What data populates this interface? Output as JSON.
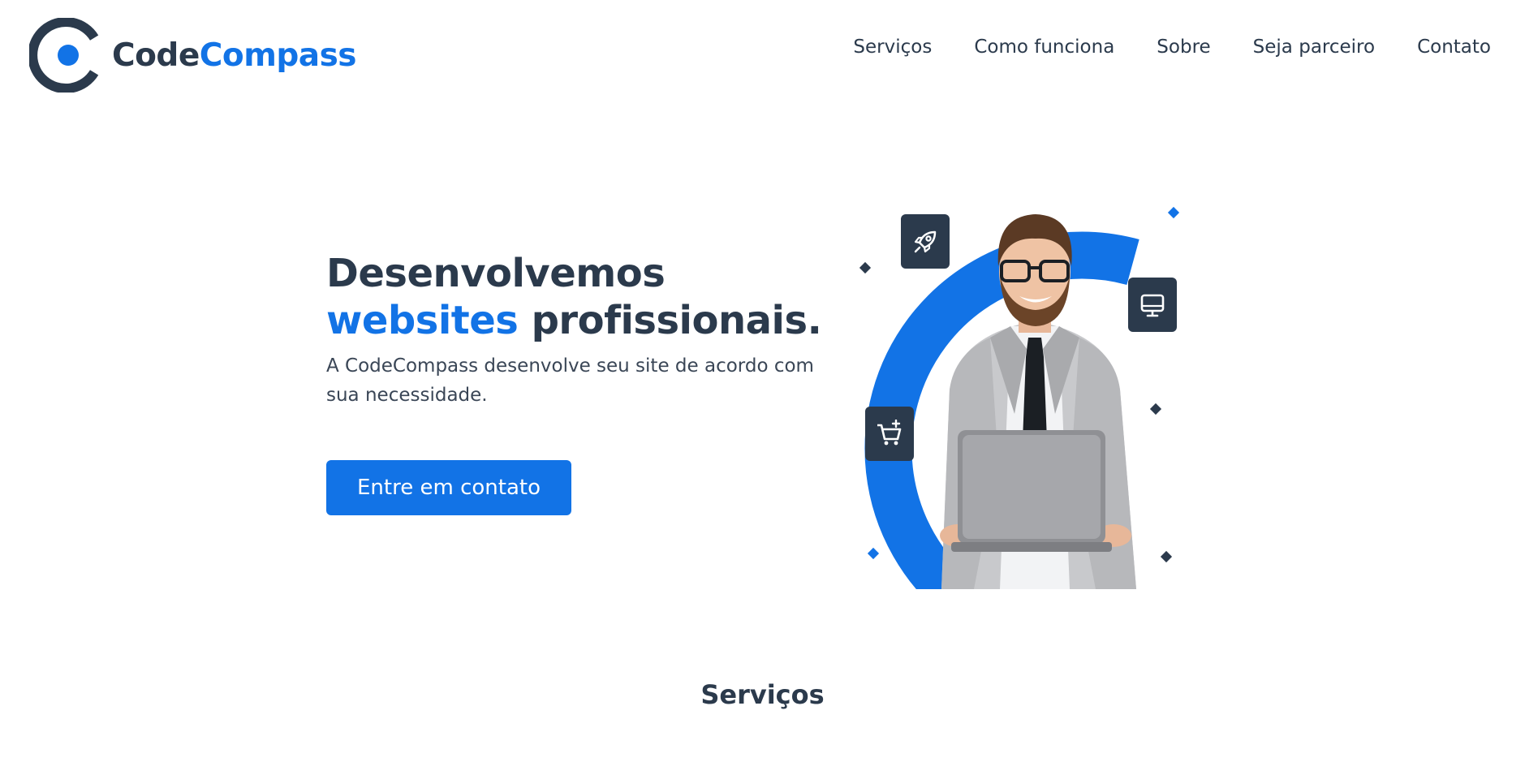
{
  "brand": {
    "name_part1": "Code",
    "name_part2": "Compass",
    "primary_color": "#1273e6",
    "dark_color": "#2b3a4c"
  },
  "nav": {
    "items": [
      {
        "label": "Serviços"
      },
      {
        "label": "Como funciona"
      },
      {
        "label": "Sobre"
      },
      {
        "label": "Seja parceiro"
      },
      {
        "label": "Contato"
      }
    ]
  },
  "hero": {
    "title_line1": "Desenvolvemos",
    "title_accent": "websites",
    "title_rest": " profissionais.",
    "subtitle": "A CodeCompass desenvolve seu site de acordo com sua necessidade.",
    "cta_label": "Entre em contato",
    "icons": [
      "rocket-icon",
      "monitor-icon",
      "cart-icon"
    ]
  },
  "services": {
    "title": "Serviços"
  }
}
